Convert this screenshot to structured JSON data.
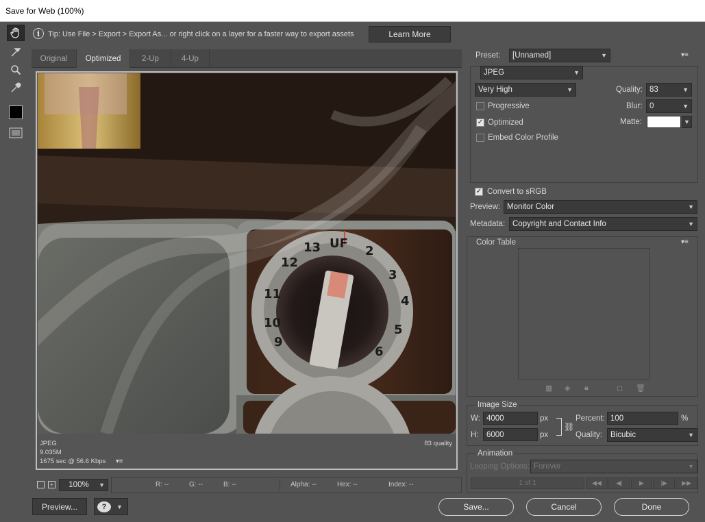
{
  "window": {
    "title": "Save for Web (100%)"
  },
  "tools": [
    {
      "name": "hand-tool",
      "icon": "hand-icon"
    },
    {
      "name": "slice-select-tool",
      "icon": "slice-select-icon"
    },
    {
      "name": "zoom-tool",
      "icon": "magnifier-icon"
    },
    {
      "name": "eyedropper-tool",
      "icon": "eyedropper-icon"
    }
  ],
  "tip": {
    "icon": "info-icon",
    "text": "Tip: Use File > Export > Export As...  or right click on a layer for a faster way to export assets",
    "button": "Learn More"
  },
  "tabs": [
    "Original",
    "Optimized",
    "2-Up",
    "4-Up"
  ],
  "active_tab": "Optimized",
  "image_info": {
    "format": "JPEG",
    "size": "9.035M",
    "time": "1675 sec @ 56.6 Kbps",
    "quality": "83 quality",
    "dial_numbers": [
      "12",
      "13",
      "UF",
      "2",
      "3",
      "4",
      "5",
      "6",
      "9",
      "10",
      "11"
    ]
  },
  "settings": {
    "preset_label": "Preset:",
    "preset_value": "[Unnamed]",
    "format": "JPEG",
    "compression": "Very High",
    "quality_label": "Quality:",
    "quality_value": "83",
    "blur_label": "Blur:",
    "blur_value": "0",
    "matte_label": "Matte:",
    "progressive": "Progressive",
    "optimized": "Optimized",
    "embed_profile": "Embed Color Profile",
    "convert_srgb": "Convert to sRGB",
    "preview_label": "Preview:",
    "preview_value": "Monitor Color",
    "metadata_label": "Metadata:",
    "metadata_value": "Copyright and Contact Info"
  },
  "color_table": {
    "title": "Color Table"
  },
  "image_size": {
    "title": "Image Size",
    "w_label": "W:",
    "w_value": "4000",
    "h_label": "H:",
    "h_value": "6000",
    "unit": "px",
    "percent_label": "Percent:",
    "percent_value": "100",
    "percent_unit": "%",
    "quality_label": "Quality:",
    "quality_value": "Bicubic"
  },
  "animation": {
    "title": "Animation",
    "looping_label": "Looping Options:",
    "looping_value": "Forever",
    "frame_counter": "1 of 1"
  },
  "status": {
    "zoom": "100%",
    "r": "R: --",
    "g": "G: --",
    "b": "B: --",
    "alpha": "Alpha: --",
    "hex": "Hex: --",
    "index": "Index: --"
  },
  "footer": {
    "preview_button": "Preview...",
    "save_button": "Save...",
    "cancel_button": "Cancel",
    "done_button": "Done"
  },
  "colors": {
    "panel": "#535353",
    "matte": "#ffffff",
    "field": "#3a3a3a"
  }
}
